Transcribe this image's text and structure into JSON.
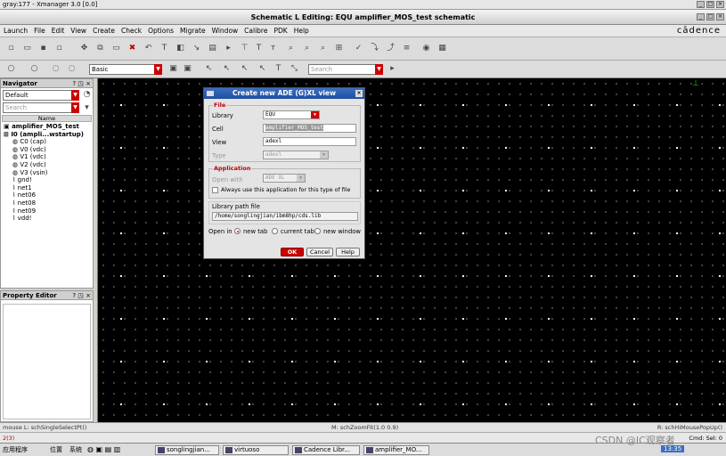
{
  "xmanager": {
    "title": "gray:177 - Xmanager 3.0 [0.0]"
  },
  "window": {
    "title": "Schematic L Editing: EQU amplifier_MOS_test schematic",
    "brand": "cādence"
  },
  "menu": [
    "Launch",
    "File",
    "Edit",
    "View",
    "Create",
    "Check",
    "Options",
    "Migrate",
    "Window",
    "Calibre",
    "PDK",
    "Help"
  ],
  "toolbar": {
    "style_combo": "Basic",
    "search_placeholder": "Search"
  },
  "navigator": {
    "title": "Navigator",
    "filter": "Default",
    "search_placeholder": "Search",
    "column": "Name",
    "tree": [
      "amplifier_MOS_test",
      "I0 (ampli...wstartup)",
      "C0 (cap)",
      "V0 (vdc)",
      "V1 (vdc)",
      "V2 (vdc)",
      "V3 (vsin)",
      "gnd!",
      "net1",
      "net06",
      "net08",
      "net09",
      "vdd!"
    ]
  },
  "property_editor": {
    "title": "Property Editor"
  },
  "dialog": {
    "title": "Create new ADE (G)XL view",
    "file_group": "File",
    "library_label": "Library",
    "library_value": "EQU",
    "cell_label": "Cell",
    "cell_value": "amplifier_MOS_test",
    "view_label": "View",
    "view_value": "adexl",
    "type_label": "Type",
    "type_value": "adexl",
    "application_group": "Application",
    "open_with_label": "Open with",
    "open_with_value": "ADE XL",
    "always_label": "Always use this application for this type of file",
    "libpath_label": "Library path file",
    "libpath_value": "/home/songlingjian/ibm8hp/cds.lib",
    "open_in_label": "Open in",
    "opt_new_tab": "new tab",
    "opt_current_tab": "current tab",
    "opt_new_window": "new window",
    "ok": "OK",
    "cancel": "Cancel",
    "help": "Help"
  },
  "status": {
    "left": "mouse L: schSingleSelectPt()",
    "mid": "M: schZoomFit(1.0 0.9)",
    "right": "R: schHiMousePopUp()"
  },
  "cmdline": {
    "prompt": "2(3)",
    "right": "Cmd: Sel: 0"
  },
  "taskbar": {
    "apps": "应用程序",
    "places": "位置",
    "system": "系统",
    "tasks": [
      "songlingjian...",
      "virtuoso",
      "Cadence Libr...",
      "amplifier_MO..."
    ],
    "time": "13:35",
    "watermark": "CSDN @IC观察者"
  }
}
